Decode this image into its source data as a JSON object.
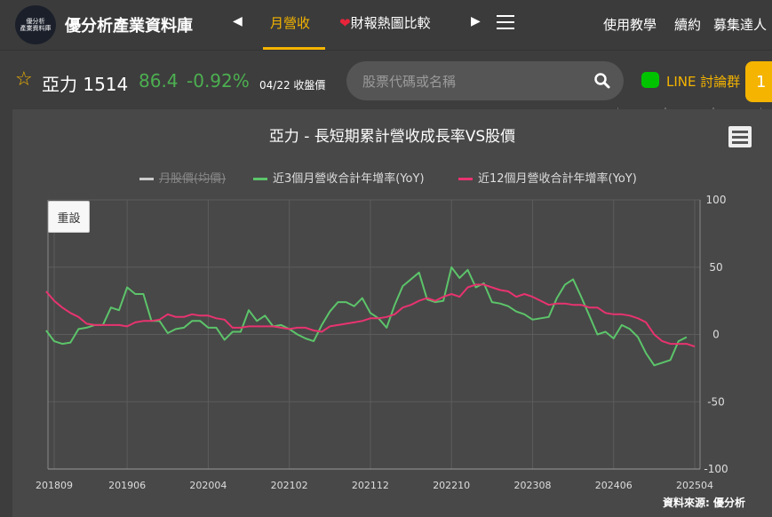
{
  "nav": {
    "logo_line1": "優分析",
    "logo_line2": "產業資料庫",
    "brand": "優分析產業資料庫",
    "tabs": [
      "月營收",
      "財報熱圖比較"
    ],
    "right_links": [
      "使用教學",
      "續約",
      "募集達人"
    ]
  },
  "stock": {
    "name": "亞力 1514",
    "price": "86.4",
    "change": "-0.92%",
    "date": "04/22 收盤價"
  },
  "search": {
    "placeholder": "股票代碼或名稱"
  },
  "line_group": "LINE 討論群",
  "badge": "1",
  "chart": {
    "title": "亞力 - 長短期累計營收成長率VS股價",
    "reset_label": "重設",
    "source": "資料來源: 優分析",
    "legend": [
      "月股價(均價)",
      "近3個月營收合計年增率(YoY)",
      "近12個月營收合計年增率(YoY)"
    ],
    "colors": {
      "price": "#cccccc",
      "yoy3": "#5cc46a",
      "yoy12": "#e8336f"
    }
  },
  "chart_data": {
    "type": "line",
    "title": "亞力 - 長短期累計營收成長率VS股價",
    "x_ticks": [
      "201809",
      "201906",
      "202004",
      "202102",
      "202112",
      "202210",
      "202308",
      "202406",
      "202504"
    ],
    "y_ticks": [
      100,
      50,
      0,
      -50,
      -100
    ],
    "ylim": [
      -100,
      100
    ],
    "x_start": "2018-08",
    "series": [
      {
        "name": "近3個月營收合計年增率(YoY)",
        "values": [
          3,
          -5,
          -7,
          -6,
          4,
          5,
          7,
          7,
          20,
          18,
          35,
          30,
          30,
          10,
          10,
          1,
          4,
          5,
          10,
          10,
          5,
          5,
          -4,
          2,
          2,
          18,
          10,
          14,
          6,
          7,
          4,
          0,
          -3,
          -5,
          7,
          17,
          24,
          24,
          21,
          27,
          16,
          12,
          5,
          22,
          36,
          41,
          46,
          26,
          24,
          25,
          50,
          42,
          48,
          35,
          38,
          24,
          23,
          21,
          17,
          15,
          11,
          12,
          13,
          27,
          37,
          41,
          28,
          14,
          0,
          2,
          -3,
          7,
          4,
          -2,
          -14,
          -23,
          -21,
          -19,
          -5,
          -2
        ],
        "visible": true
      },
      {
        "name": "近12個月營收合計年增率(YoY)",
        "values": [
          32,
          25,
          20,
          16,
          13,
          8,
          7,
          7,
          7,
          7,
          6,
          9,
          10,
          10,
          11,
          15,
          13,
          13,
          15,
          14,
          14,
          12,
          11,
          5,
          5,
          6,
          6,
          6,
          6,
          5,
          4,
          5,
          5,
          3,
          2,
          6,
          7,
          8,
          9,
          10,
          12,
          12,
          13,
          15,
          20,
          22,
          25,
          27,
          25,
          28,
          30,
          28,
          35,
          37,
          37,
          35,
          33,
          32,
          28,
          30,
          28,
          25,
          22,
          23,
          23,
          22,
          22,
          20,
          20,
          16,
          15,
          15,
          14,
          12,
          9,
          0,
          -5,
          -7,
          -7,
          -7,
          -9
        ],
        "visible": true
      },
      {
        "name": "月股價(均價)",
        "values": [],
        "visible": false
      }
    ],
    "grid": true,
    "legend_position": "top"
  }
}
